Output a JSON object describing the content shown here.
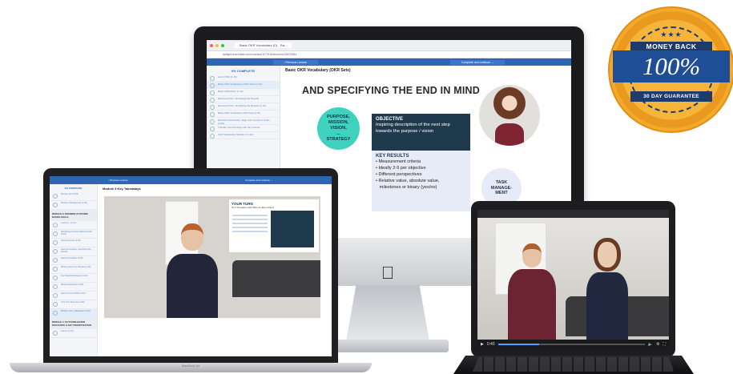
{
  "imac": {
    "tab_title": "Basic OKR Vocabulary (O) - Ra...",
    "url": "fairlight.teachable.com/courses/1172154/lectures/26433344",
    "prev_label": "‹ Previous Lecture",
    "complete_label": "Complete and continue →",
    "progress": "0% COMPLETE",
    "lesson_title": "Basic OKR Vocabulary (OKR Sets)",
    "slide": {
      "heading": "AND SPECIFYING THE END IN MIND",
      "purpose_lines": [
        "PURPOSE,",
        "MISSION,",
        "VISION,",
        "...",
        "STRATEGY"
      ],
      "objective_title": "OBJECTIVE",
      "objective_text": "Inspiring description of the next step towards the purpose / vision",
      "kr_title": "KEY RESULTS",
      "kr_items": [
        "• Measurement criteria",
        "• Ideally 2-5 per objective",
        "• Different perspectives",
        "• Relative value, absolute value,",
        "   milestones or binary (yes/no)"
      ],
      "task_lines": [
        "TASK",
        "MANAGE-",
        "MENT"
      ]
    },
    "sidebar_items": [
      "Last (OKR) (1:18)",
      "Basic OKR Vocabulary (OKR Sets) (1:11)",
      "Basic OKR Prism (1:11)",
      "Exercise Prism: Identifying the Results",
      "Exercise Prism: Identifying the Results (1:30)",
      "Basic OKR Vocabulary OKR Sets (1:10)",
      "Exercise Introduction: Align with Counter's Goals (2:30)",
      "Tutorial: How the Align with the Counter",
      "OKR Vocabulary Module 2 (1:10)"
    ]
  },
  "macbook": {
    "model_label": "MacBook Air",
    "prev_label": "‹ Previous Lecture",
    "complete_label": "Complete and continue →",
    "progress": "0% COMPLETE",
    "lesson_title": "Module 3 Key Takeaways",
    "section_1": "MODULE 3: DEFINING OUTCOME-BASED GOALS",
    "section_2": "MODULE 4: OUTCOME-BASED DISCOVERY & KEY PRIORITISATION",
    "sidebar_items": [
      "Module Intro (2:05)",
      "Module 3 Background (1:30)",
      "Lesson 1: (1:13)",
      "Identifying Outcome-Based Goals (2:20)",
      "Quick Exercise (1:25)",
      "Exercise Solution: Identifying the Results",
      "Exercise Solution (1:30)",
      "Writing Good Key Results (1:13)",
      "Key Results Examples (1:10)",
      "Module Reflection (2:50)",
      "Tips for Good OKRs (1:10)",
      "Your Turn Exercise (1:30)",
      "Module 3 Key Takeaways (1:15)",
      "Lesson (1:13)"
    ],
    "your_turn_title": "YOUR TURN",
    "your_turn_sub": "OLC Simulation with different data pointers"
  },
  "tablet": {
    "time_label": "0:40",
    "progress_fraction": 0.28
  },
  "badge": {
    "stars": "★★★",
    "top_text": "MONEY BACK",
    "main_text": "100%",
    "bottom_text": "30 DAY GUARANTEE"
  },
  "imac_logo": "apple-logo"
}
